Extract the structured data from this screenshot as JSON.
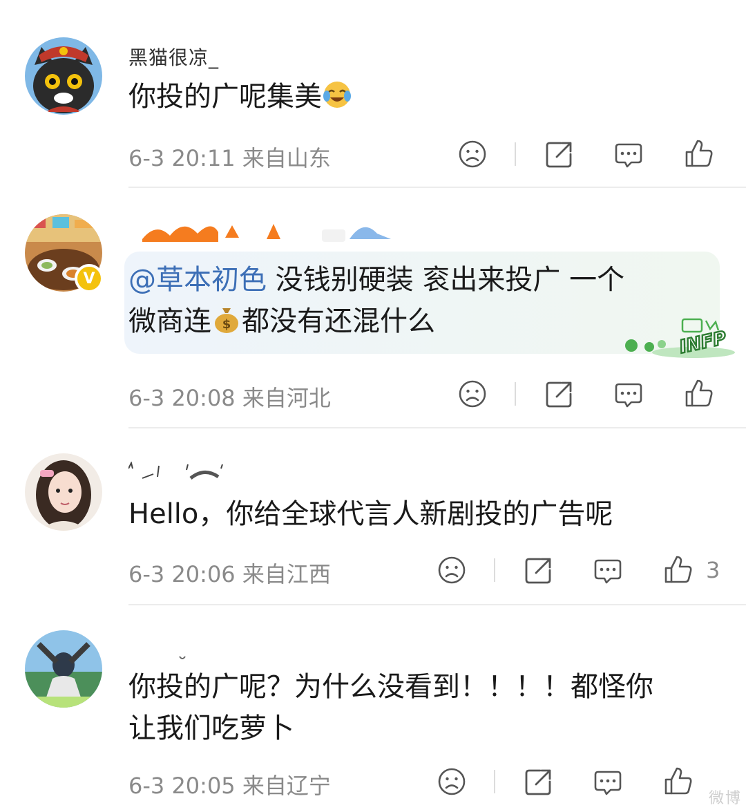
{
  "comments": [
    {
      "username": "黑猫很凉_",
      "text": "你投的广呢集美",
      "time": "6-3 20:11",
      "location": "来自山东",
      "likes": ""
    },
    {
      "username": "",
      "mention": "@草本初色",
      "text_line1": " 没钱别硬装 衮出来投广 一个",
      "text_line2_a": "微商连",
      "text_line2_b": "都没有还混什么",
      "time": "6-3 20:08",
      "location": "来自河北",
      "likes": ""
    },
    {
      "username": "",
      "text": "Hello，你给全球代言人新剧投的广告呢",
      "time": "6-3 20:06",
      "location": "来自江西",
      "likes": "3"
    },
    {
      "username": "",
      "text_line1": "你投的广呢？为什么没看到！！！！都怪你",
      "text_line2": "让我们吃萝卜",
      "time": "6-3 20:05",
      "location": "来自辽宁",
      "likes": ""
    }
  ],
  "sticker_text": "INFP",
  "icons": [
    "dislike-icon",
    "share-icon",
    "reply-icon",
    "like-icon"
  ],
  "colors": {
    "mention": "#3d6fb6",
    "meta": "#8a8a8a",
    "badge": "#f4c20d"
  },
  "watermark": "微博"
}
